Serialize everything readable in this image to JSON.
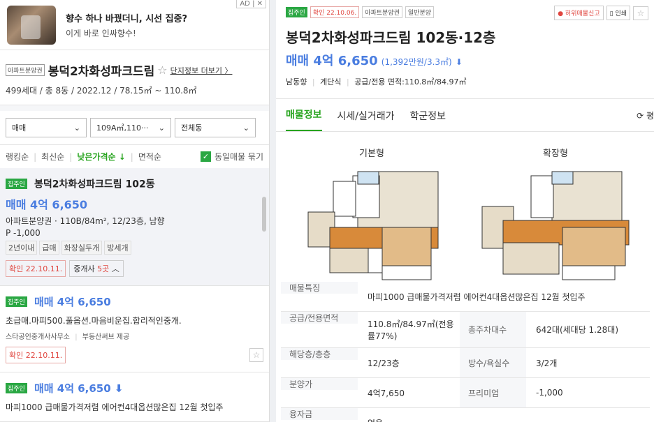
{
  "ad": {
    "badge": "AD | ✕",
    "title": "향수 하나 바꿨더니, 시선 집중?",
    "subtitle": "이게 바로 인싸향수!"
  },
  "complex": {
    "tag": "아파트분양권",
    "name": "봉덕2차화성파크드림",
    "star": "☆",
    "more": "단지정보 더보기 〉",
    "meta": "499세대 / 총 8동 / 2022.12 / 78.15㎡ ~ 110.8㎡"
  },
  "filters": [
    {
      "label": "매매",
      "arrow": "⌄"
    },
    {
      "label": "109A㎡,110···",
      "arrow": "⌄"
    },
    {
      "label": "전체동",
      "arrow": "⌄"
    }
  ],
  "sort": {
    "items": [
      "랭킹순",
      "최신순",
      "낮은가격순 ↓",
      "면적순"
    ],
    "active_index": 2,
    "check_label": "동일매물 묶기",
    "check_mark": "✓"
  },
  "listings": [
    {
      "badge": "집주인",
      "title": "봉덕2차화성파크드림 102동",
      "price": "매매 4억 6,650",
      "desc": "아파트분양권 · 110B/84m², 12/23층, 남향",
      "line2": "P -1,000",
      "chips": [
        "2년이내",
        "급매",
        "화장실두개",
        "방세개"
      ],
      "confirm": "확인 22.10.11.",
      "agents_prefix": "중개사 ",
      "agents_count": "5곳",
      "agents_suffix": " ︿"
    },
    {
      "badge": "집주인",
      "price": "매매 4억 6,650",
      "desc": "초급매.마피500.풀옵션.마음비운집.합리적인중개.",
      "office": "스타공인중개사사무소",
      "office_source": "부동산써브 제공",
      "confirm": "확인 22.10.11.",
      "star": "☆"
    },
    {
      "badge": "집주인",
      "price": "매매 4억 6,650 ⬇",
      "desc": "마피1000 급매물가격저렴 에어컨4대옵션많은집 12월 첫입주"
    }
  ],
  "detail": {
    "tags": {
      "owner": "집주인",
      "confirm": "확인 22.10.06.",
      "type": "아파트분양권",
      "kind": "일반분양"
    },
    "actions": {
      "report": "허위매물신고",
      "print": "인쇄",
      "star": "☆"
    },
    "title": "봉덕2차화성파크드림 102동·12층",
    "price_main": "매매 4억 6,650",
    "price_unit": "(1,392만원/3.3㎡)",
    "price_arrow": "⬇",
    "meta": [
      "남동향",
      "계단식",
      "공급/전용 면적:110.8㎡/84.97㎡"
    ],
    "tabs": [
      "매물정보",
      "시세/실거래가",
      "학군정보"
    ],
    "tab_right": "⟳ 평",
    "plans": [
      "기본형",
      "확장형"
    ],
    "info": [
      {
        "k": "매물특징",
        "v": "마피1000 급매물가격저렴 에어컨4대옵션많은집 12월 첫입주"
      },
      {
        "k": "공급/전용면적",
        "v": "110.8㎡/84.97㎡(전용률77%)",
        "k2": "총주차대수",
        "v2": "642대(세대당 1.28대)"
      },
      {
        "k": "해당층/총층",
        "v": "12/23층",
        "k2": "방수/욕실수",
        "v2": "3/2개"
      },
      {
        "k": "분양가",
        "v": "4억7,650",
        "k2": "프리미엄",
        "v2": "-1,000"
      },
      {
        "k": "융자금",
        "v": "없음"
      }
    ]
  }
}
